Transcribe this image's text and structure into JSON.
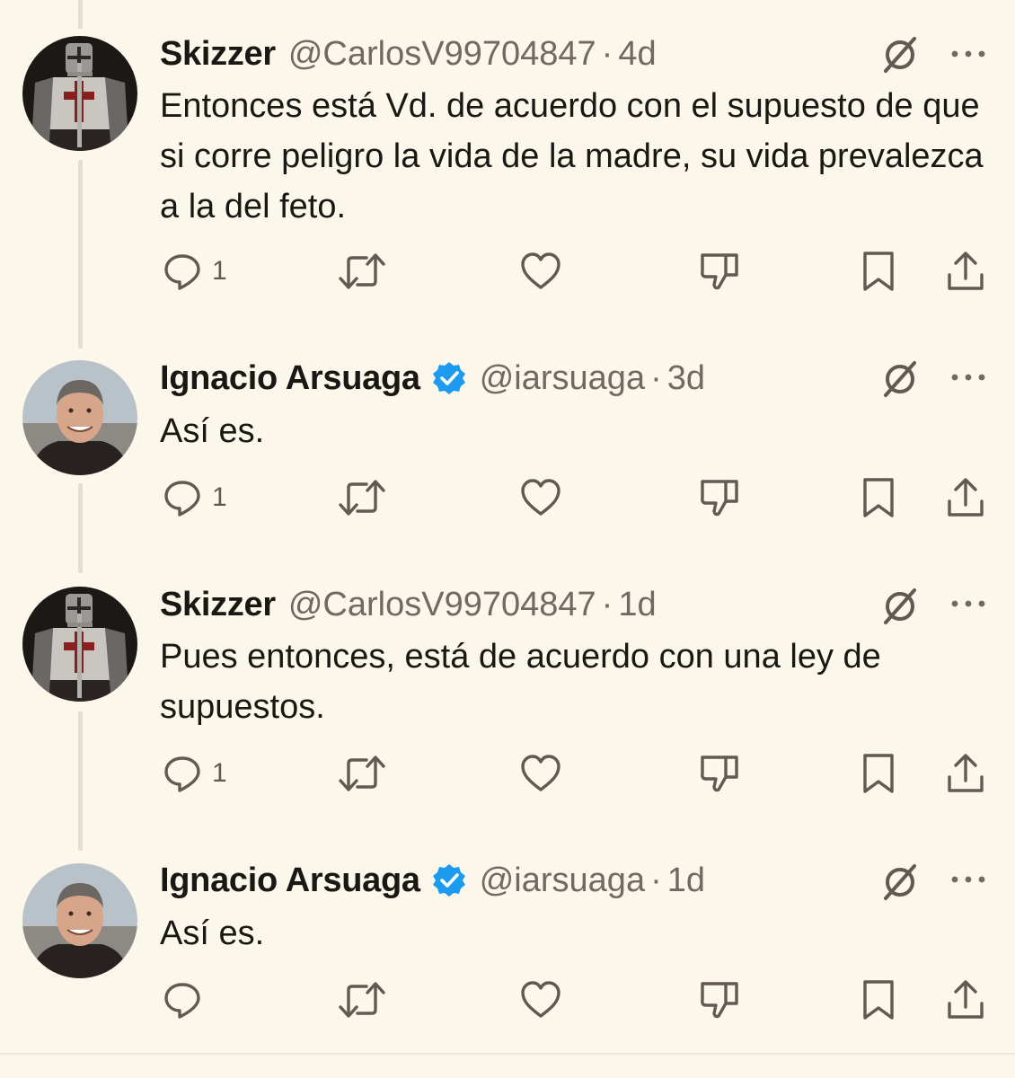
{
  "tweets": [
    {
      "name": "Skizzer",
      "handle": "@CarlosV99704847",
      "separator": "·",
      "time": "4d",
      "verified": false,
      "avatar": "knight-avatar",
      "text": "Entonces está Vd. de acuerdo con el supuesto de que si corre peligro la vida de la madre, su vida prevalezca a la del feto.",
      "reply_count": "1"
    },
    {
      "name": "Ignacio Arsuaga",
      "handle": "@iarsuaga",
      "separator": "·",
      "time": "3d",
      "verified": true,
      "avatar": "man-portrait-avatar",
      "text": "Así es.",
      "reply_count": "1"
    },
    {
      "name": "Skizzer",
      "handle": "@CarlosV99704847",
      "separator": "·",
      "time": "1d",
      "verified": false,
      "avatar": "knight-avatar",
      "text": "Pues entonces, está de acuerdo con una ley de supuestos.",
      "reply_count": "1"
    },
    {
      "name": "Ignacio Arsuaga",
      "handle": "@iarsuaga",
      "separator": "·",
      "time": "1d",
      "verified": true,
      "avatar": "man-portrait-avatar",
      "text": "Así es.",
      "reply_count": ""
    }
  ],
  "icons": {
    "reply": "reply-icon",
    "retweet": "retweet-icon",
    "like": "heart-icon",
    "dislike": "thumbs-down-icon",
    "bookmark": "bookmark-icon",
    "share": "share-icon",
    "grok": "grok-icon",
    "more": "more-icon",
    "verified": "verified-badge-icon"
  },
  "colors": {
    "background": "#fbf7ea",
    "text": "#1a1714",
    "secondary": "#6f6a62",
    "icon": "#5f5a52",
    "verified": "#1d9bf0",
    "thread_line": "#e3ded3"
  }
}
